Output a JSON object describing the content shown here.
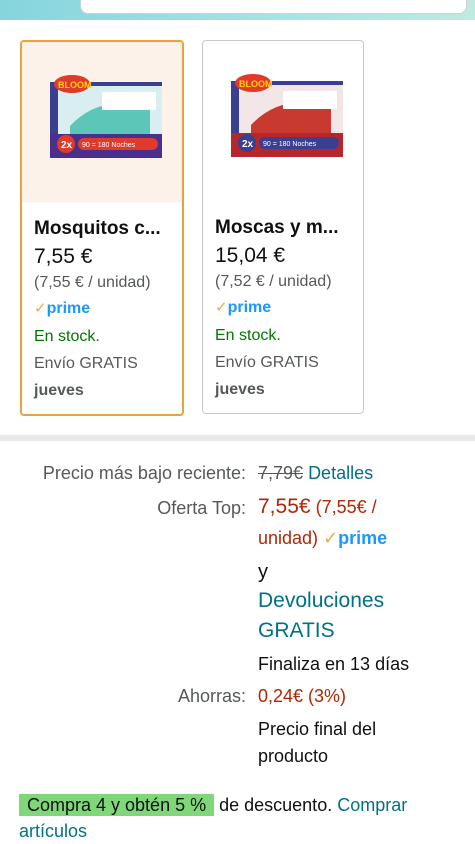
{
  "colors": {
    "accent_orange": "#e8a33c",
    "link": "#007185",
    "price_red": "#b12704",
    "stock_green": "#007600",
    "prime_blue": "#1a98ff",
    "promo_green": "#7fd77a"
  },
  "products": [
    {
      "name": "Mosquitos c...",
      "price": "7,55 €",
      "unit_price": "(7,55 € / unidad)",
      "prime_check": "✓",
      "prime_label": "prime",
      "stock": "En stock.",
      "shipping": "Envío GRATIS",
      "delivery_day": "jueves",
      "image_brand": "BLOOM",
      "image_badge": "2x",
      "image_badge_text": "90 = 180 Noches"
    },
    {
      "name": "Moscas y m...",
      "price": "15,04 €",
      "unit_price": "(7,52 € / unidad)",
      "prime_check": "✓",
      "prime_label": "prime",
      "stock": "En stock.",
      "shipping": "Envío GRATIS",
      "delivery_day": "jueves",
      "image_brand": "BLOOM",
      "image_badge": "2x",
      "image_badge_text": "90 = 180 Noches"
    }
  ],
  "details": {
    "recent_low_label": "Precio más bajo reciente:",
    "recent_low_price": "7,79€",
    "recent_low_link": "Detalles",
    "offer_label": "Oferta Top:",
    "offer_price": "7,55€",
    "offer_unit_line1": "(7,55€ /",
    "offer_unit_line2": "unidad)",
    "prime_check": "✓",
    "prime_label": "prime",
    "conj": "y",
    "returns_line1": "Devoluciones",
    "returns_line2": "GRATIS",
    "ends": "Finaliza en 13 días",
    "savings_label": "Ahorras:",
    "savings_value": "0,24€ (3%)",
    "final_line1": "Precio final del",
    "final_line2": "producto"
  },
  "promo": {
    "badge": "Compra 4 y obtén 5 %",
    "text": " de descuento. ",
    "link_line1": "Comprar",
    "link_line2": "artículos"
  }
}
